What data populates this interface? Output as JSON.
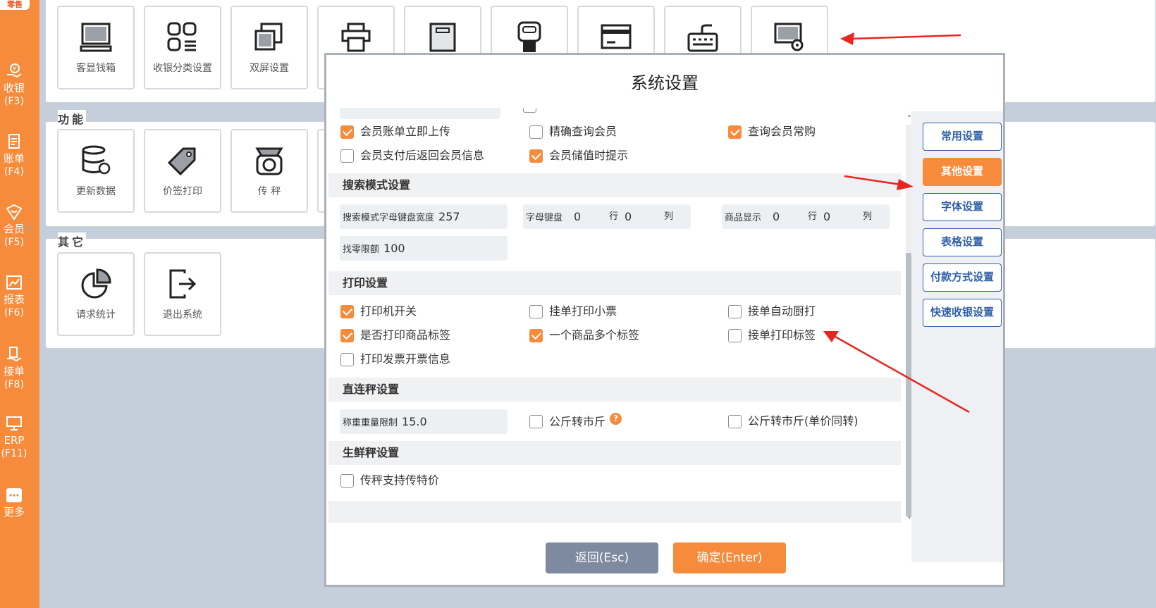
{
  "sidebar": {
    "logo": "零售",
    "items": [
      {
        "label": "收银",
        "key": "(F3)"
      },
      {
        "label": "账单",
        "key": "(F4)"
      },
      {
        "label": "会员",
        "key": "(F5)"
      },
      {
        "label": "报表",
        "key": "(F6)"
      },
      {
        "label": "接单",
        "key": "(F8)"
      },
      {
        "label": "ERP",
        "key": "(F11)"
      },
      {
        "label": "更多",
        "key": ""
      }
    ]
  },
  "panels": {
    "top_tiles": [
      "客显钱箱",
      "收银分类设置",
      "双屏设置"
    ],
    "function_title": "功能",
    "function_tiles": [
      "更新数据",
      "价签打印",
      "传 秤"
    ],
    "other_title": "其它",
    "other_tiles": [
      "请求统计",
      "退出系统"
    ]
  },
  "modal": {
    "title": "系统设置",
    "member_options": [
      {
        "label": "会员账单立即上传",
        "checked": true
      },
      {
        "label": "精确查询会员",
        "checked": false
      },
      {
        "label": "查询会员常购",
        "checked": true
      },
      {
        "label": "会员支付后返回会员信息",
        "checked": false
      },
      {
        "label": "会员储值时提示",
        "checked": true
      }
    ],
    "search_section": {
      "title": "搜索模式设置",
      "keyboard_width_label": "搜索模式字母键盘宽度",
      "keyboard_width_value": "257",
      "letter_kb_label": "字母键盘",
      "letter_kb_rows": "0",
      "letter_kb_cols": "",
      "goods_display_label": "商品显示",
      "goods_rows": "0",
      "goods_cols": "",
      "row_unit": "行",
      "col_unit": "列",
      "change_limit_label": "找零限额",
      "change_limit_value": "100"
    },
    "print_section": {
      "title": "打印设置",
      "options": [
        {
          "label": "打印机开关",
          "checked": true
        },
        {
          "label": "挂单打印小票",
          "checked": false
        },
        {
          "label": "接单自动厨打",
          "checked": false
        },
        {
          "label": "是否打印商品标签",
          "checked": true
        },
        {
          "label": "一个商品多个标签",
          "checked": true
        },
        {
          "label": "接单打印标签",
          "checked": false
        },
        {
          "label": "打印发票开票信息",
          "checked": false
        }
      ]
    },
    "scale_section": {
      "title": "直连秤设置",
      "weight_limit_label": "称重重量限制",
      "weight_limit_value": "15.0",
      "kg_to_jin": {
        "label": "公斤转市斤",
        "checked": false
      },
      "help": "?",
      "kg_to_jin_price": {
        "label": "公斤转市斤(单价同转)",
        "checked": false
      }
    },
    "fresh_section": {
      "title": "生鲜秤设置",
      "special_price": {
        "label": "传秤支持传特价",
        "checked": false
      }
    },
    "right_menu": [
      "常用设置",
      "其他设置",
      "字体设置",
      "表格设置",
      "付款方式设置",
      "快速收银设置"
    ],
    "active_menu": "其他设置",
    "back_button": "返回(Esc)",
    "confirm_button": "确定(Enter)"
  },
  "colors": {
    "accent": "#f68b3c",
    "nav_blue": "#2f5fa8",
    "arrow": "#e8261f"
  }
}
